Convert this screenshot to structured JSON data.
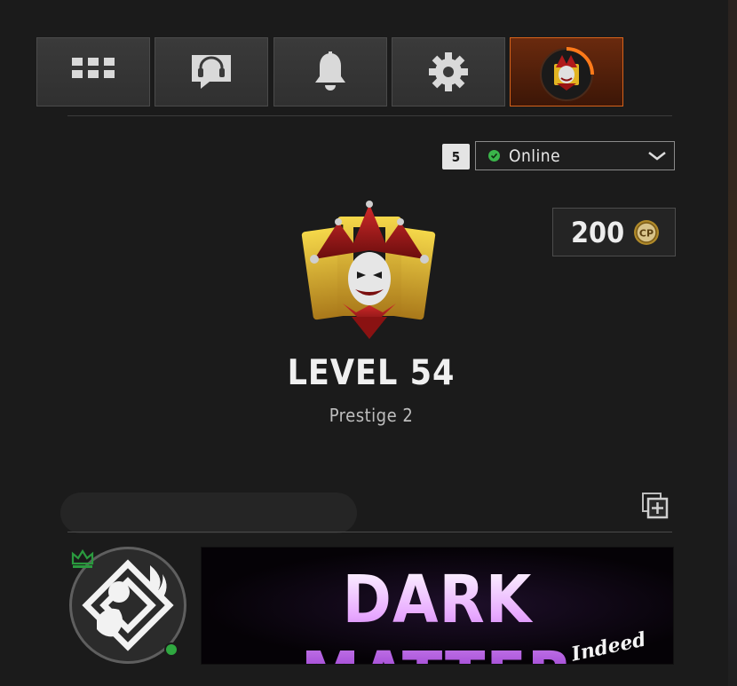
{
  "nav": {
    "tabs": [
      {
        "name": "apps",
        "icon": "grid-icon"
      },
      {
        "name": "social",
        "icon": "headset-chat-icon"
      },
      {
        "name": "notifications",
        "icon": "bell-icon"
      },
      {
        "name": "settings",
        "icon": "gear-icon"
      },
      {
        "name": "profile",
        "icon": "jester-emblem-icon",
        "active": true
      }
    ]
  },
  "status": {
    "party_count": "5",
    "selected": "Online",
    "color": "#3ab54a"
  },
  "currency": {
    "amount": "200",
    "coin_label": "CP"
  },
  "player": {
    "level_label": "LEVEL 54",
    "prestige_label": "Prestige 2"
  },
  "calling_card": {
    "title": "DARK MATTER",
    "subtitle": "Indeed"
  },
  "colors": {
    "accent": "#d6621a",
    "online": "#3ab54a",
    "crown": "#2a9a3e"
  }
}
